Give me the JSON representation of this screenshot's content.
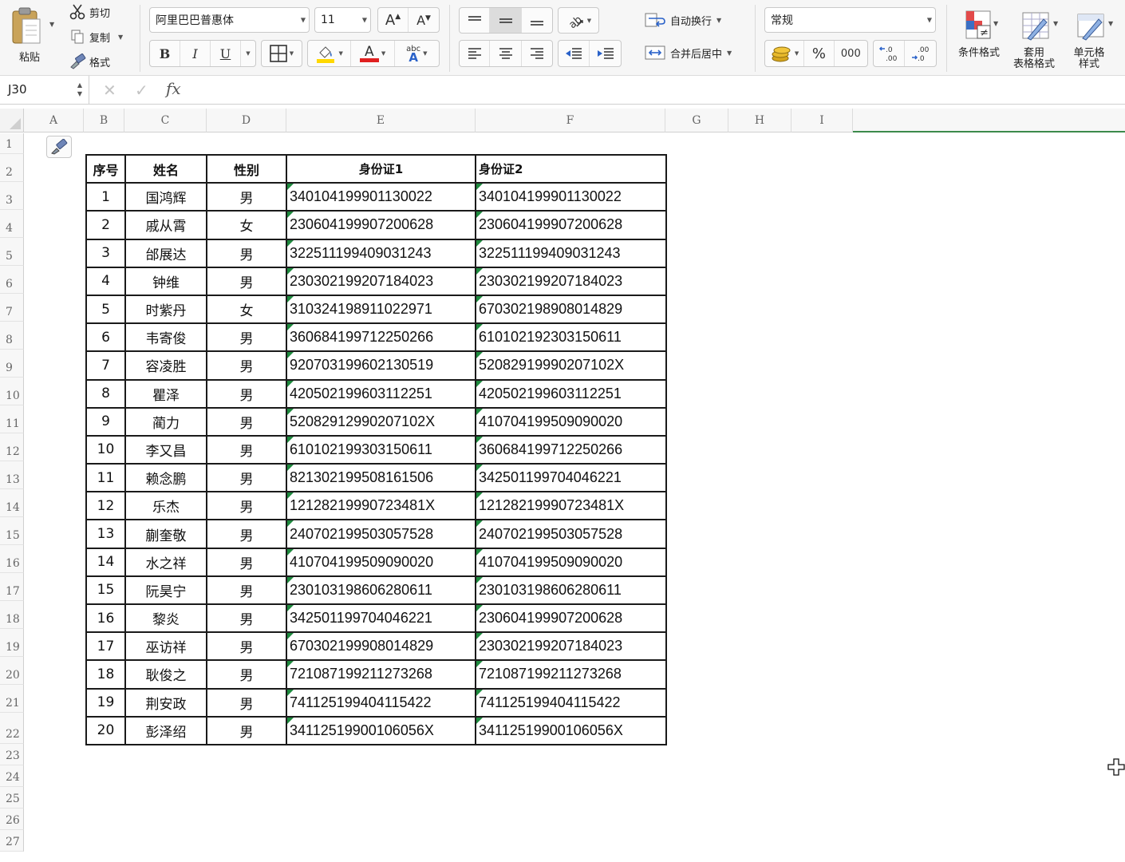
{
  "ribbon": {
    "paste_label": "粘贴",
    "cut_label": "剪切",
    "copy_label": "复制",
    "format_painter_label": "格式",
    "font_name": "阿里巴巴普惠体",
    "font_size": "11",
    "grow_font": "A",
    "shrink_font": "A",
    "bold": "B",
    "italic": "I",
    "underline": "U",
    "font_color_glyph": "A",
    "phonetic_glyph": "abc",
    "wrap_text_label": "自动换行",
    "merge_center_label": "合并后居中",
    "number_format": "常规",
    "percent": "%",
    "thousands": "000",
    "conditional_format_label": "条件格式",
    "table_format_line1": "套用",
    "table_format_line2": "表格格式",
    "cell_style_line1": "单元格",
    "cell_style_line2": "样式",
    "colors": {
      "font_color": "#e02020",
      "fill_color": "#ffd800",
      "accent": "#1e8a3e"
    }
  },
  "formula_bar": {
    "cell_ref": "J30",
    "cancel_glyph": "✕",
    "confirm_glyph": "✓",
    "fx": "fx",
    "content": ""
  },
  "sheet": {
    "columns": [
      "A",
      "B",
      "C",
      "D",
      "E",
      "F",
      "G",
      "H",
      "I"
    ],
    "rows": [
      "1",
      "2",
      "3",
      "4",
      "5",
      "6",
      "7",
      "8",
      "9",
      "10",
      "11",
      "12",
      "13",
      "14",
      "15",
      "16",
      "17",
      "18",
      "19",
      "20",
      "21",
      "22",
      "23",
      "24",
      "25",
      "26",
      "27"
    ],
    "table": {
      "headers": [
        "序号",
        "姓名",
        "性别",
        "身份证1",
        "身份证2"
      ],
      "rows": [
        [
          "1",
          "国鸿辉",
          "男",
          "340104199901130022",
          "340104199901130022"
        ],
        [
          "2",
          "戚从霄",
          "女",
          "230604199907200628",
          "230604199907200628"
        ],
        [
          "3",
          "邰展达",
          "男",
          "322511199409031243",
          "322511199409031243"
        ],
        [
          "4",
          "钟维",
          "男",
          "230302199207184023",
          "230302199207184023"
        ],
        [
          "5",
          "时紫丹",
          "女",
          "310324198911022971",
          "670302198908014829"
        ],
        [
          "6",
          "韦寄俊",
          "男",
          "360684199712250266",
          "610102192303150611"
        ],
        [
          "7",
          "容凌胜",
          "男",
          "920703199602130519",
          "52082919990207102X"
        ],
        [
          "8",
          "瞿泽",
          "男",
          "420502199603112251",
          "420502199603112251"
        ],
        [
          "9",
          "蔺力",
          "男",
          "52082912990207102X",
          "410704199509090020"
        ],
        [
          "10",
          "李又昌",
          "男",
          "610102199303150611",
          "360684199712250266"
        ],
        [
          "11",
          "赖念鹏",
          "男",
          "821302199508161506",
          "342501199704046221"
        ],
        [
          "12",
          "乐杰",
          "男",
          "12128219990723481X",
          "12128219990723481X"
        ],
        [
          "13",
          "蒯奎敬",
          "男",
          "240702199503057528",
          "240702199503057528"
        ],
        [
          "14",
          "水之祥",
          "男",
          "410704199509090020",
          "410704199509090020"
        ],
        [
          "15",
          "阮昊宁",
          "男",
          "230103198606280611",
          "230103198606280611"
        ],
        [
          "16",
          "黎炎",
          "男",
          "342501199704046221",
          "230604199907200628"
        ],
        [
          "17",
          "巫访祥",
          "男",
          "670302199908014829",
          "230302199207184023"
        ],
        [
          "18",
          "耿俊之",
          "男",
          "721087199211273268",
          "721087199211273268"
        ],
        [
          "19",
          "荆安政",
          "男",
          "741125199404115422",
          "741125199404115422"
        ],
        [
          "20",
          "彭泽绍",
          "男",
          "34112519900106056X",
          "34112519900106056X"
        ]
      ]
    }
  }
}
